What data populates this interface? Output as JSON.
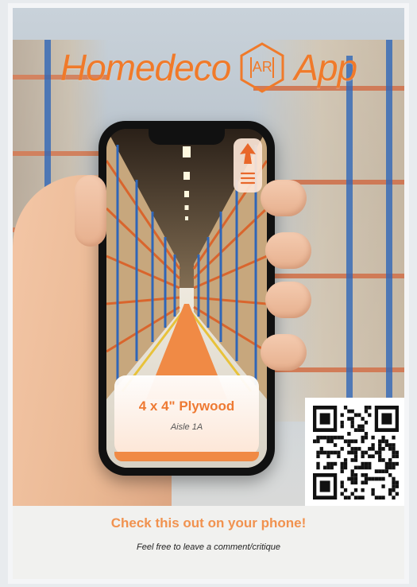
{
  "poster": {
    "title_left": "Homedeco",
    "title_badge": "AR",
    "title_right": "App",
    "product_name": "4 x 4\" Plywood",
    "product_location": "Aisle 1A",
    "cta": "Check this out on your phone!",
    "subtext": "Feel free to leave a comment/critique"
  },
  "colors": {
    "accent": "#f07a2a",
    "rack_blue": "#2f66b8",
    "rack_orange": "#d9652d"
  },
  "icons": [
    "hexagon-ar-icon",
    "pointer-arrow-icon",
    "menu-icon",
    "qr-code"
  ]
}
